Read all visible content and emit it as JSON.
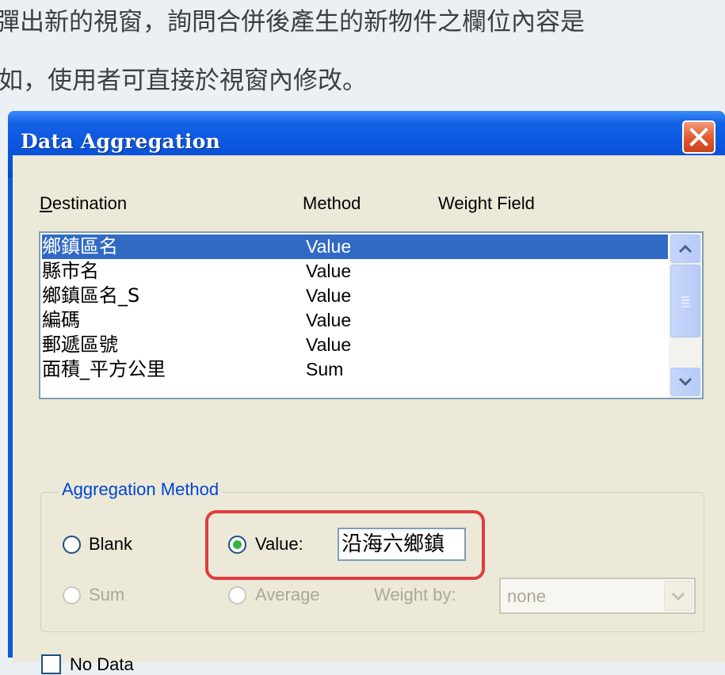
{
  "caption": {
    "line1": "彈出新的視窗，詢問合併後產生的新物件之欄位內容是",
    "line2": "如，使用者可直接於視窗內修改。"
  },
  "dialog": {
    "title": "Data Aggregation",
    "headers": {
      "destination": "Destination",
      "method": "Method",
      "weight_field": "Weight Field"
    },
    "rows": [
      {
        "destination": "鄉鎮區名",
        "method": "Value",
        "selected": true
      },
      {
        "destination": "縣市名",
        "method": "Value"
      },
      {
        "destination": "鄉鎮區名_S",
        "method": "Value"
      },
      {
        "destination": "編碼",
        "method": "Value"
      },
      {
        "destination": "郵遞區號",
        "method": "Value"
      },
      {
        "destination": "面積_平方公里",
        "method": "Sum"
      }
    ],
    "aggregation": {
      "legend": "Aggregation Method",
      "blank_label": "Blank",
      "value_label": "Value:",
      "value_input": "沿海六鄉鎮",
      "sum_label": "Sum",
      "average_label": "Average",
      "weight_by_label": "Weight by:",
      "weight_by_value": "none",
      "selected": "Value"
    },
    "no_data_label": "No Data"
  },
  "colors": {
    "accent": "#0b58d8",
    "selection": "#316ac5",
    "highlight": "#e03c3c",
    "radio_dot": "#3cb043"
  }
}
